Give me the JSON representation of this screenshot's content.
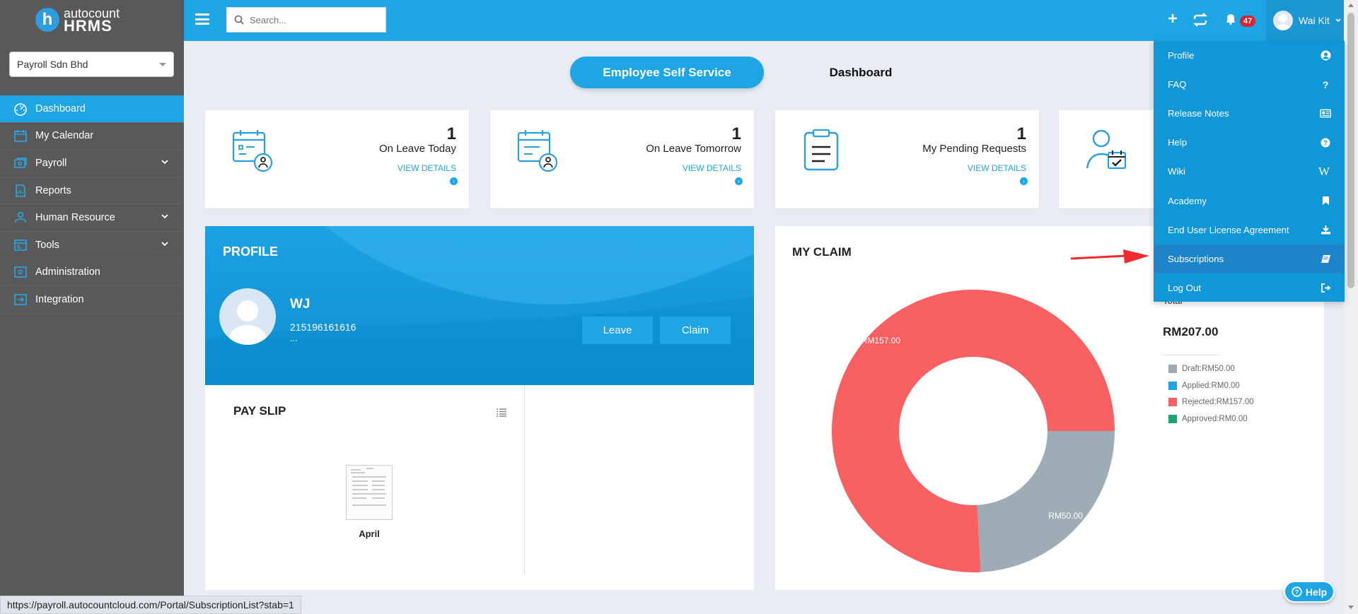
{
  "brand": {
    "logo_letter": "h",
    "line1": "autocount",
    "line2": "HRMS"
  },
  "company_select": {
    "value": "Payroll Sdn Bhd"
  },
  "sidebar": {
    "items": [
      {
        "label": "Dashboard",
        "icon": "dashboard-icon",
        "active": true
      },
      {
        "label": "My Calendar",
        "icon": "calendar-icon"
      },
      {
        "label": "Payroll",
        "icon": "payroll-icon",
        "expandable": true
      },
      {
        "label": "Reports",
        "icon": "reports-icon"
      },
      {
        "label": "Human Resource",
        "icon": "human-resource-icon",
        "expandable": true
      },
      {
        "label": "Tools",
        "icon": "tools-icon",
        "expandable": true
      },
      {
        "label": "Administration",
        "icon": "administration-icon"
      },
      {
        "label": "Integration",
        "icon": "integration-icon"
      }
    ]
  },
  "topbar": {
    "search_placeholder": "Search...",
    "notification_count": "47",
    "user_name": "Wai Kit"
  },
  "tabs": {
    "ess": "Employee Self Service",
    "dashboard": "Dashboard"
  },
  "cards": [
    {
      "count": "1",
      "label": "On Leave Today",
      "link": "VIEW DETAILS"
    },
    {
      "count": "1",
      "label": "On Leave Tomorrow",
      "link": "VIEW DETAILS"
    },
    {
      "count": "1",
      "label": "My Pending Requests",
      "link": "VIEW DETAILS"
    }
  ],
  "profile": {
    "title": "PROFILE",
    "name": "WJ",
    "id": "215196161616",
    "extra": "...",
    "leave_btn": "Leave",
    "claim_btn": "Claim"
  },
  "payslip": {
    "title": "PAY SLIP",
    "month": "April"
  },
  "claim": {
    "title": "MY CLAIM",
    "total_label": "Total",
    "total": "RM207.00",
    "legend": [
      {
        "label": "Draft:RM50.00",
        "color": "#9eadb5"
      },
      {
        "label": "Applied:RM0.00",
        "color": "#1ea5e3"
      },
      {
        "label": "Rejected:RM157.00",
        "color": "#f86062"
      },
      {
        "label": "Approved:RM0.00",
        "color": "#1aa673"
      }
    ]
  },
  "chart_data": {
    "type": "pie",
    "categories": [
      "Draft",
      "Applied",
      "Rejected",
      "Approved"
    ],
    "values": [
      50,
      0,
      157,
      0
    ],
    "data_labels": [
      "RM50.00",
      "",
      "RM157.00",
      ""
    ],
    "colors": [
      "#9eadb5",
      "#1ea5e3",
      "#f86062",
      "#1aa673"
    ]
  },
  "user_menu": {
    "items": [
      {
        "label": "Profile",
        "icon": "user-circle-icon"
      },
      {
        "label": "FAQ",
        "icon": "question-icon"
      },
      {
        "label": "Release Notes",
        "icon": "newspaper-icon"
      },
      {
        "label": "Help",
        "icon": "help-circle-icon"
      },
      {
        "label": "Wiki",
        "icon": "wikipedia-icon"
      },
      {
        "label": "Academy",
        "icon": "bookmark-icon"
      },
      {
        "label": "End User License Agreement",
        "icon": "download-icon"
      },
      {
        "label": "Subscriptions",
        "icon": "book-icon",
        "highlighted": true
      },
      {
        "label": "Log Out",
        "icon": "logout-icon"
      }
    ]
  },
  "status_bar": {
    "url": "https://payroll.autocountcloud.com/Portal/SubscriptionList?stab=1"
  },
  "help_button": {
    "label": "Help"
  }
}
